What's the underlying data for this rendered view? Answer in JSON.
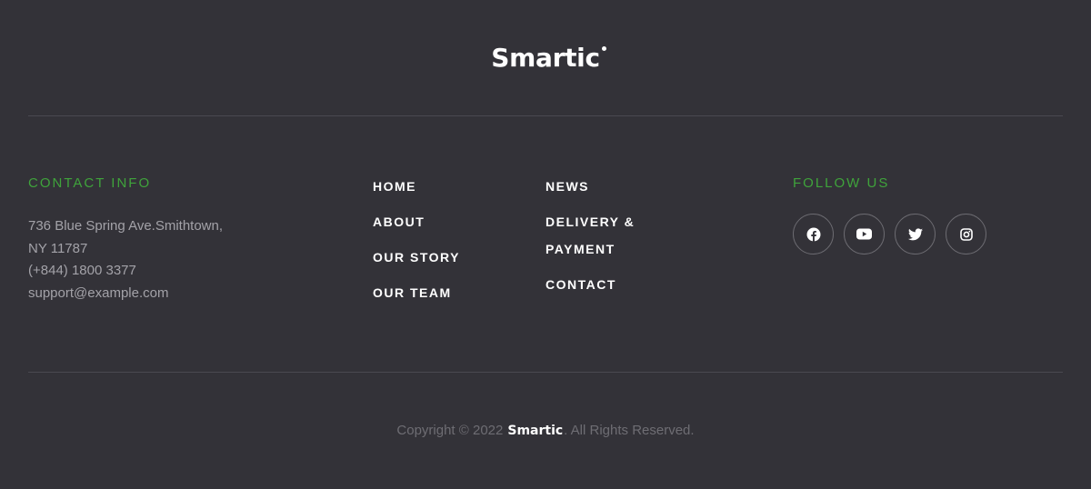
{
  "brand": {
    "logo_text": "Smartic"
  },
  "contact": {
    "title": "CONTACT INFO",
    "lines": [
      "736 Blue Spring Ave.Smithtown,",
      "NY 11787",
      "(+844) 1800 3377",
      "support@example.com"
    ]
  },
  "nav": {
    "col1": [
      "HOME",
      "ABOUT",
      "OUR STORY",
      "OUR TEAM"
    ],
    "col2": [
      "NEWS",
      "DELIVERY & PAYMENT",
      "CONTACT"
    ]
  },
  "follow": {
    "title": "FOLLOW US",
    "icons": [
      "facebook-icon",
      "youtube-icon",
      "twitter-icon",
      "instagram-icon"
    ]
  },
  "copyright": {
    "prefix": "Copyright © 2022",
    "brand": "Smartic",
    "suffix": ". All Rights Reserved."
  },
  "colors": {
    "background": "#333238",
    "accent": "#3fa33b",
    "muted_text": "#a3a2a8",
    "divider": "#4a4950"
  }
}
